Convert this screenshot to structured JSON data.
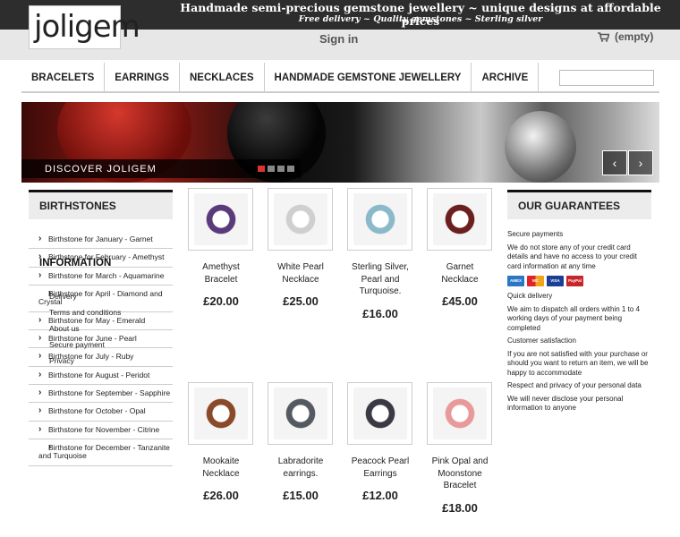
{
  "header": {
    "logo": "joligem",
    "tagline": "Handmade semi-precious gemstone jewellery ~ unique designs at affordable prices",
    "subtagline": "Free delivery ~ Quality gemstones ~ Sterling silver",
    "signin": "Sign in",
    "cart": "(empty)"
  },
  "nav": {
    "items": [
      "Bracelets",
      "Earrings",
      "Necklaces",
      "Handmade Gemstone Jewellery",
      "Archive"
    ],
    "search_placeholder": ""
  },
  "banner": {
    "caption": "Discover Joligem",
    "prev": "‹",
    "next": "›",
    "slides": 4,
    "active_slide": 1
  },
  "birthstones": {
    "title": "Birthstones",
    "items": [
      "Birthstone for January - Garnet",
      "Birthstone for February - Amethyst",
      "Birthstone for March - Aquamarine",
      "Birthstone for April - Diamond and Crystal",
      "Birthstone for May - Emerald",
      "Birthstone for June - Pearl",
      "Birthstone for July - Ruby",
      "Birthstone for August - Peridot",
      "Birthstone for September - Sapphire",
      "Birthstone for October - Opal",
      "Birthstone for November - Citrine",
      "Birthstone for December - Tanzanite and Turquoise"
    ]
  },
  "information": {
    "title": "Information",
    "links": [
      "Delivery",
      "Terms and conditions",
      "About us",
      "Secure payment",
      "Privacy"
    ]
  },
  "products": [
    {
      "name": "Amethyst Bracelet",
      "price": "£20.00",
      "color": "#5a3a7a"
    },
    {
      "name": "White Pearl Necklace",
      "price": "£25.00",
      "color": "#cfcfcf"
    },
    {
      "name": "Sterling Silver, Pearl and Turquoise.",
      "price": "£16.00",
      "color": "#8ab9c9"
    },
    {
      "name": "Garnet Necklace",
      "price": "£45.00",
      "color": "#6b1f1f"
    },
    {
      "name": "Mookaite Necklace",
      "price": "£26.00",
      "color": "#8a4a2a"
    },
    {
      "name": "Labradorite earrings.",
      "price": "£15.00",
      "color": "#555a60"
    },
    {
      "name": "Peacock Pearl Earrings",
      "price": "£12.00",
      "color": "#3a3a44"
    },
    {
      "name": "Pink Opal and Moonstone Bracelet",
      "price": "£18.00",
      "color": "#e89a9a"
    }
  ],
  "guarantees": {
    "title": "Our Guarantees",
    "secure_title": "Secure payments",
    "secure_text": "We do not store any of your credit card details and have no access to your credit card information at any time",
    "cards": [
      "AMEX",
      "MC",
      "VISA",
      "PayPal"
    ],
    "delivery_title": "Quick delivery",
    "delivery_text": "We aim to dispatch all orders within 1 to 4 working days of your payment being completed",
    "satisfaction_title": "Customer satisfaction",
    "satisfaction_text": "If you are not satisfied with your purchase or should you want to return an item, we will be happy to accommodate",
    "privacy_title": "Respect and privacy of your personal data",
    "privacy_text": "We will never disclose your personal information to anyone"
  }
}
